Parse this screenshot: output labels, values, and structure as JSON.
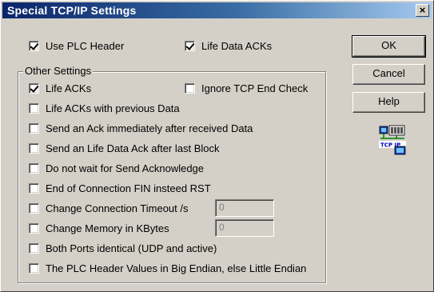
{
  "window": {
    "title": "Special TCP/IP Settings",
    "close_label": "×"
  },
  "top_options": [
    {
      "label": "Use PLC Header",
      "checked": true
    },
    {
      "label": "Life Data ACKs",
      "checked": true
    }
  ],
  "group": {
    "legend": "Other Settings",
    "life_acks": {
      "label": "Life ACKs",
      "checked": true
    },
    "ignore_tcp_end": {
      "label": "Ignore TCP End Check",
      "checked": false
    },
    "items": [
      {
        "label": "Life ACKs with previous Data",
        "checked": false
      },
      {
        "label": "Send an Ack immediately after received Data",
        "checked": false
      },
      {
        "label": "Send an Life Data Ack after last Block",
        "checked": false
      },
      {
        "label": "Do not wait for Send Acknowledge",
        "checked": false
      },
      {
        "label": "End of Connection FIN insteed RST",
        "checked": false
      },
      {
        "label": "Change Connection Timeout /s",
        "checked": false,
        "value": "0"
      },
      {
        "label": "Change Memory in KBytes",
        "checked": false,
        "value": "0"
      },
      {
        "label": "Both Ports identical (UDP and active)",
        "checked": false
      },
      {
        "label": "The PLC Header Values in Big Endian, else Little Endian",
        "checked": false
      }
    ]
  },
  "buttons": {
    "ok": "OK",
    "cancel": "Cancel",
    "help": "Help"
  },
  "icon": {
    "name": "tcp-ip-icon",
    "caption": "TCP IP"
  }
}
